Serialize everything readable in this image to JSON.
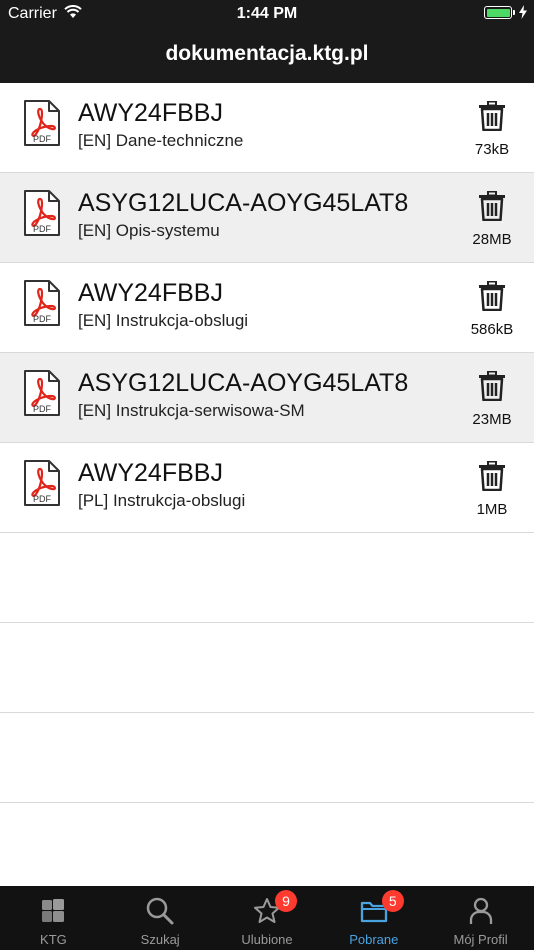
{
  "status_bar": {
    "carrier": "Carrier",
    "time": "1:44 PM"
  },
  "header": {
    "title": "dokumentacja.ktg.pl"
  },
  "documents": [
    {
      "title": "AWY24FBBJ",
      "subtitle": "[EN] Dane-techniczne",
      "size": "73kB",
      "icon": "pdf-icon"
    },
    {
      "title": "ASYG12LUCA-AOYG45LAT8",
      "subtitle": "[EN] Opis-systemu",
      "size": "28MB",
      "icon": "pdf-icon"
    },
    {
      "title": "AWY24FBBJ",
      "subtitle": "[EN] Instrukcja-obslugi",
      "size": "586kB",
      "icon": "pdf-icon"
    },
    {
      "title": "ASYG12LUCA-AOYG45LAT8",
      "subtitle": "[EN] Instrukcja-serwisowa-SM",
      "size": "23MB",
      "icon": "pdf-icon"
    },
    {
      "title": "AWY24FBBJ",
      "subtitle": "[PL] Instrukcja-obslugi",
      "size": "1MB",
      "icon": "pdf-icon"
    }
  ],
  "tabs": [
    {
      "label": "KTG",
      "icon": "ktg-logo-icon",
      "badge": null
    },
    {
      "label": "Szukaj",
      "icon": "search-icon",
      "badge": null
    },
    {
      "label": "Ulubione",
      "icon": "star-icon",
      "badge": "9"
    },
    {
      "label": "Pobrane",
      "icon": "folder-icon",
      "badge": "5",
      "active": true
    },
    {
      "label": "Mój Profil",
      "icon": "person-icon",
      "badge": null
    }
  ],
  "colors": {
    "bar_background": "#1a1a1a",
    "active_tab": "#4aa3df",
    "badge": "#ff3b30",
    "alt_row": "#efefef",
    "pdf_red": "#e0251b"
  }
}
